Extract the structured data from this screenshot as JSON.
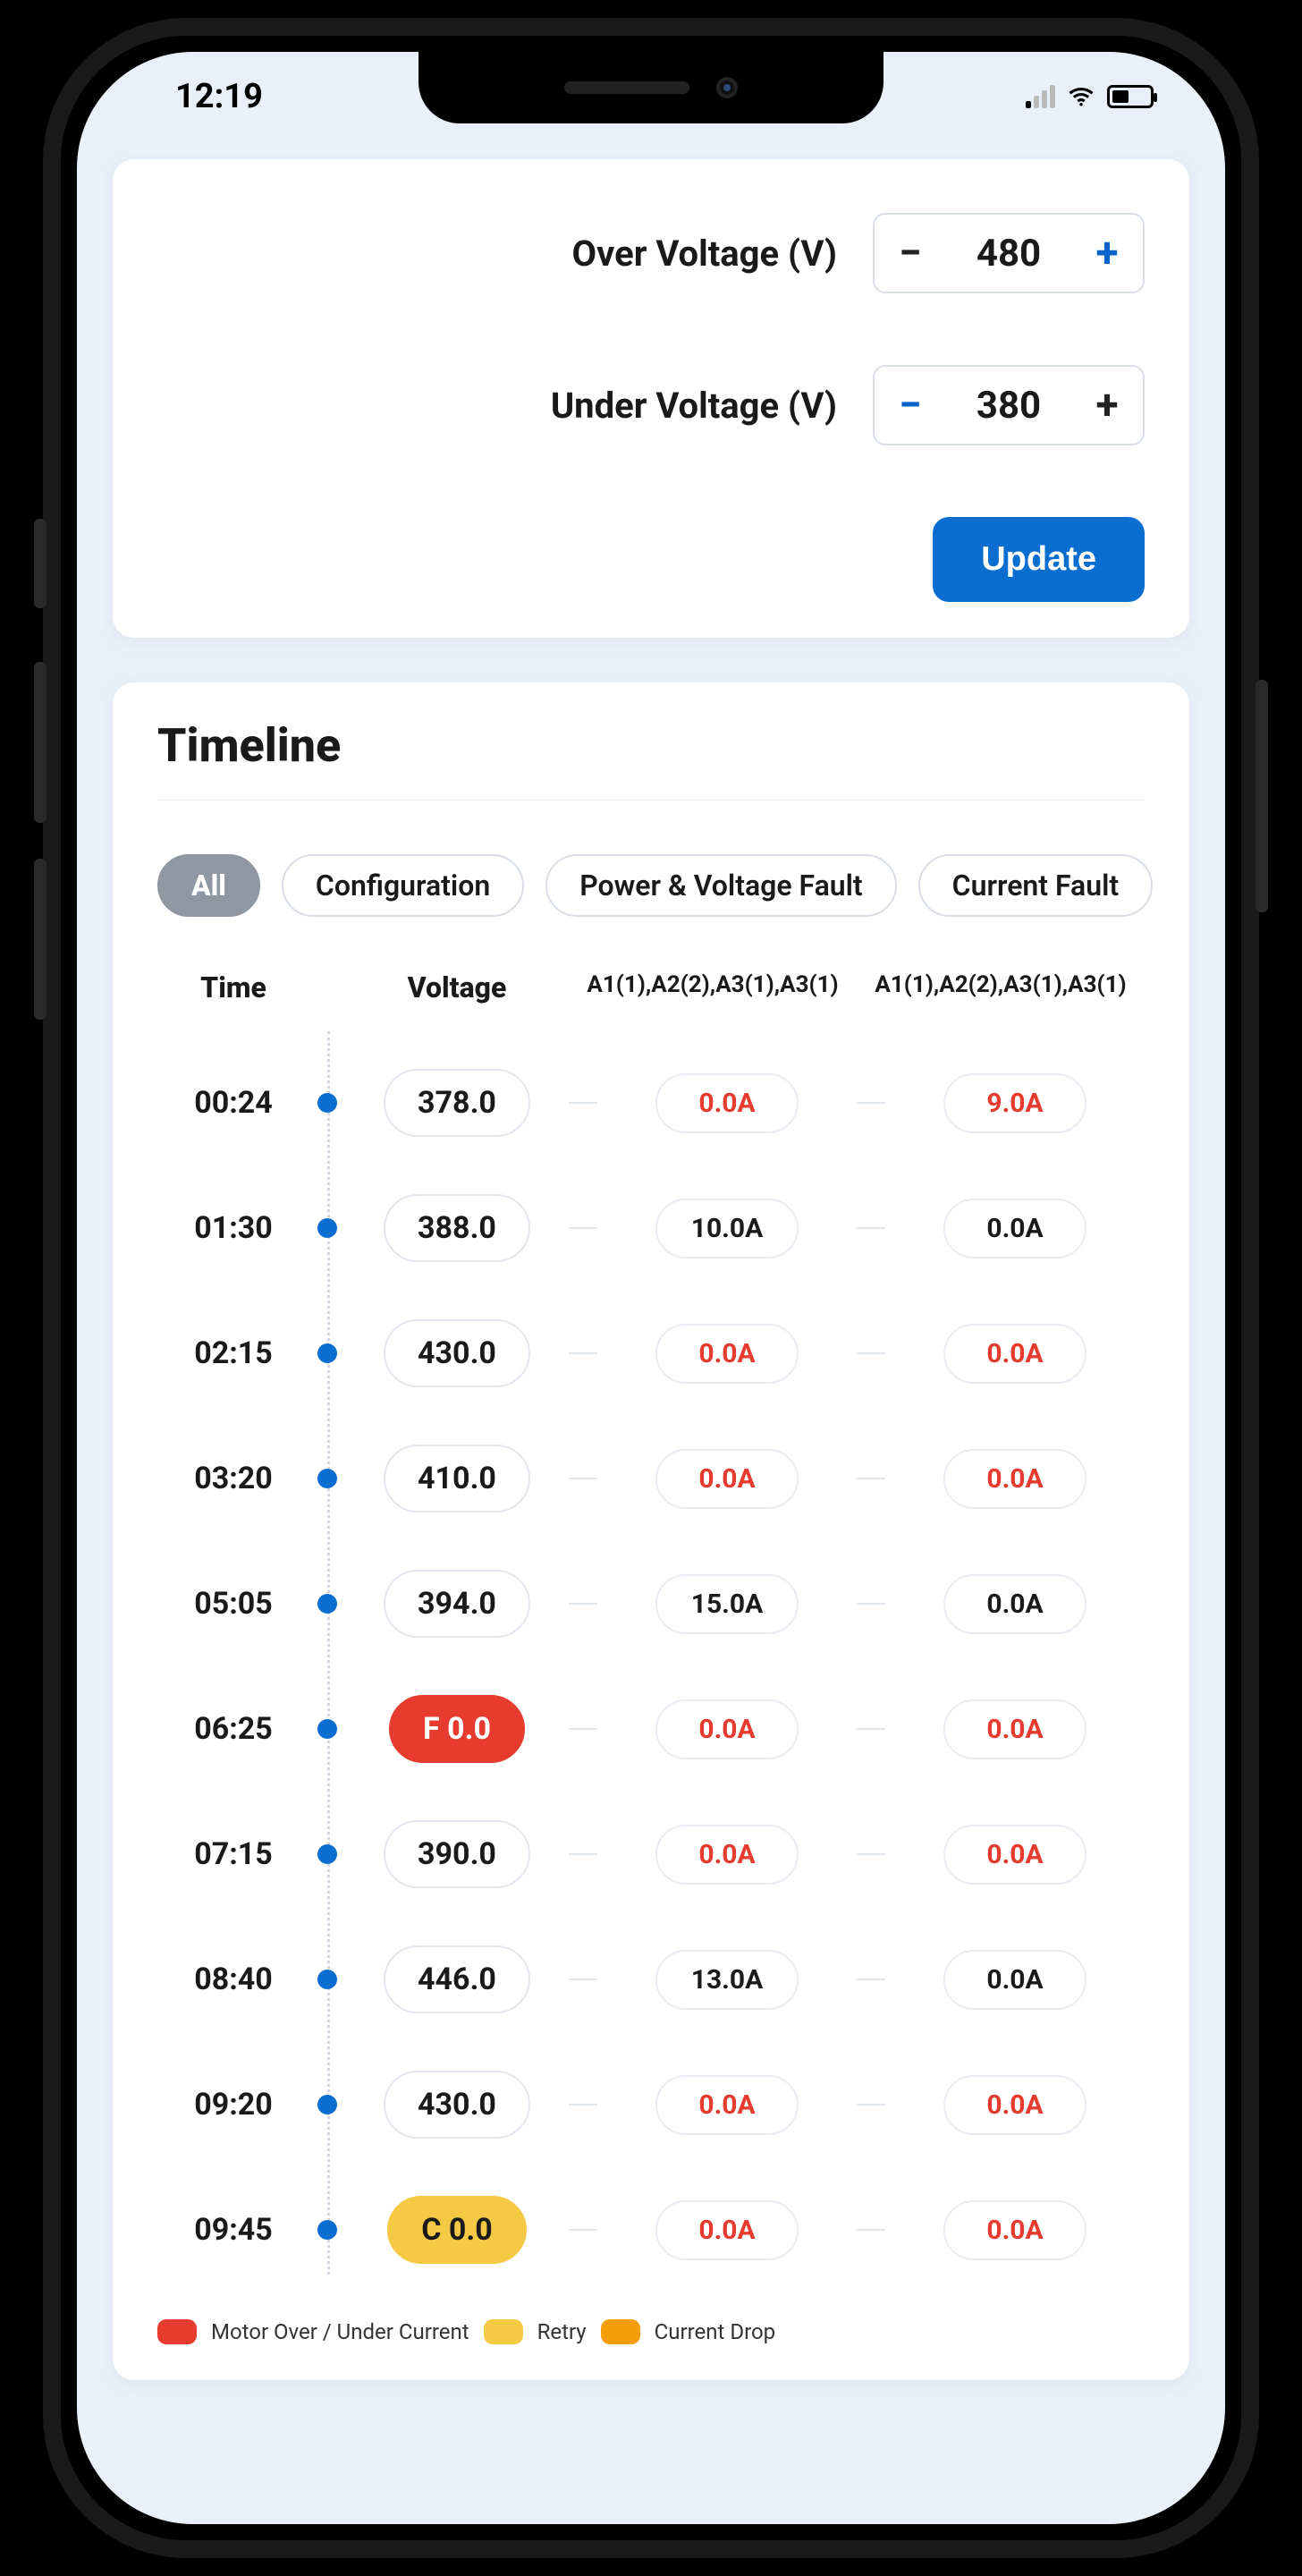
{
  "status": {
    "time": "12:19",
    "battery_pct": 40,
    "signal_bars_on": 1
  },
  "settings": {
    "over_voltage": {
      "label": "Over Voltage (V)",
      "value": "480"
    },
    "under_voltage": {
      "label": "Under Voltage (V)",
      "value": "380"
    },
    "update_label": "Update"
  },
  "timeline": {
    "title": "Timeline",
    "filters": {
      "all": "All",
      "configuration": "Configuration",
      "power_voltage_fault": "Power & Voltage Fault",
      "current_fault": "Current Fault"
    },
    "headers": {
      "time": "Time",
      "voltage": "Voltage",
      "amp1": "A1(1),A2(2),A3(1),A3(1)",
      "amp2": "A1(1),A2(2),A3(1),A3(1)"
    },
    "rows": [
      {
        "time": "00:24",
        "voltage": "378.0",
        "vstyle": "normal",
        "a1": "0.0A",
        "a1_fault": true,
        "a2": "9.0A",
        "a2_fault": true
      },
      {
        "time": "01:30",
        "voltage": "388.0",
        "vstyle": "normal",
        "a1": "10.0A",
        "a1_fault": false,
        "a2": "0.0A",
        "a2_fault": false
      },
      {
        "time": "02:15",
        "voltage": "430.0",
        "vstyle": "normal",
        "a1": "0.0A",
        "a1_fault": true,
        "a2": "0.0A",
        "a2_fault": true
      },
      {
        "time": "03:20",
        "voltage": "410.0",
        "vstyle": "normal",
        "a1": "0.0A",
        "a1_fault": true,
        "a2": "0.0A",
        "a2_fault": true
      },
      {
        "time": "05:05",
        "voltage": "394.0",
        "vstyle": "normal",
        "a1": "15.0A",
        "a1_fault": false,
        "a2": "0.0A",
        "a2_fault": false
      },
      {
        "time": "06:25",
        "voltage": "F 0.0",
        "vstyle": "red",
        "a1": "0.0A",
        "a1_fault": true,
        "a2": "0.0A",
        "a2_fault": true
      },
      {
        "time": "07:15",
        "voltage": "390.0",
        "vstyle": "normal",
        "a1": "0.0A",
        "a1_fault": true,
        "a2": "0.0A",
        "a2_fault": true
      },
      {
        "time": "08:40",
        "voltage": "446.0",
        "vstyle": "normal",
        "a1": "13.0A",
        "a1_fault": false,
        "a2": "0.0A",
        "a2_fault": false
      },
      {
        "time": "09:20",
        "voltage": "430.0",
        "vstyle": "normal",
        "a1": "0.0A",
        "a1_fault": true,
        "a2": "0.0A",
        "a2_fault": true
      },
      {
        "time": "09:45",
        "voltage": "C 0.0",
        "vstyle": "yellow",
        "a1": "0.0A",
        "a1_fault": true,
        "a2": "0.0A",
        "a2_fault": true
      }
    ],
    "legend": {
      "motor": "Motor Over / Under Current",
      "retry": "Retry",
      "current_drop": "Current Drop"
    }
  }
}
